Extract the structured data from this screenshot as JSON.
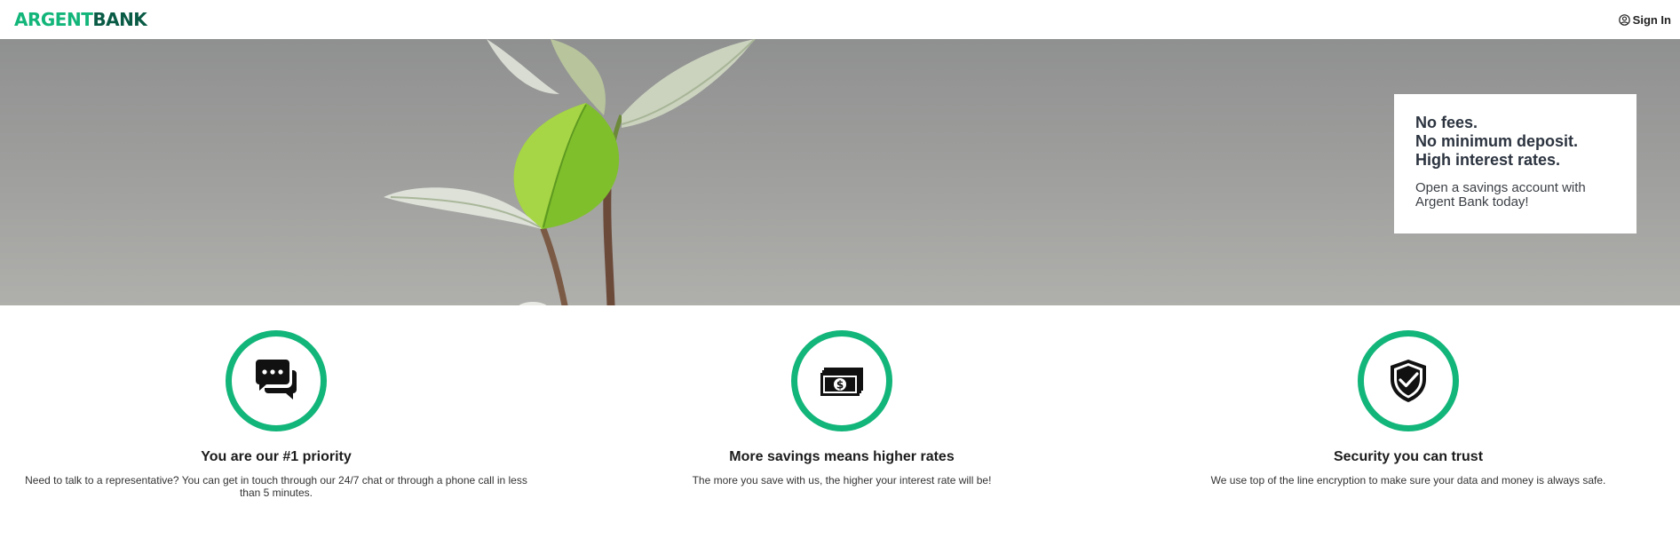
{
  "header": {
    "logo_part1": "ARGENT",
    "logo_part2": "BANK",
    "signin_label": "Sign In",
    "signin_icon": "user-circle-icon"
  },
  "colors": {
    "brand_green": "#12b57a",
    "brand_dark_green": "#0a5b46"
  },
  "hero": {
    "image": "green-plant-sprout",
    "headline_1": "No fees.",
    "headline_2": "No minimum deposit.",
    "headline_3": "High interest rates.",
    "subtext": "Open a savings account with Argent Bank today!"
  },
  "features": [
    {
      "icon": "chat-icon",
      "title": "You are our #1 priority",
      "text": "Need to talk to a representative? You can get in touch through our 24/7 chat or through a phone call in less than 5 minutes."
    },
    {
      "icon": "money-icon",
      "title": "More savings means higher rates",
      "text": "The more you save with us, the higher your interest rate will be!"
    },
    {
      "icon": "security-shield-icon",
      "title": "Security you can trust",
      "text": "We use top of the line encryption to make sure your data and money is always safe."
    }
  ]
}
